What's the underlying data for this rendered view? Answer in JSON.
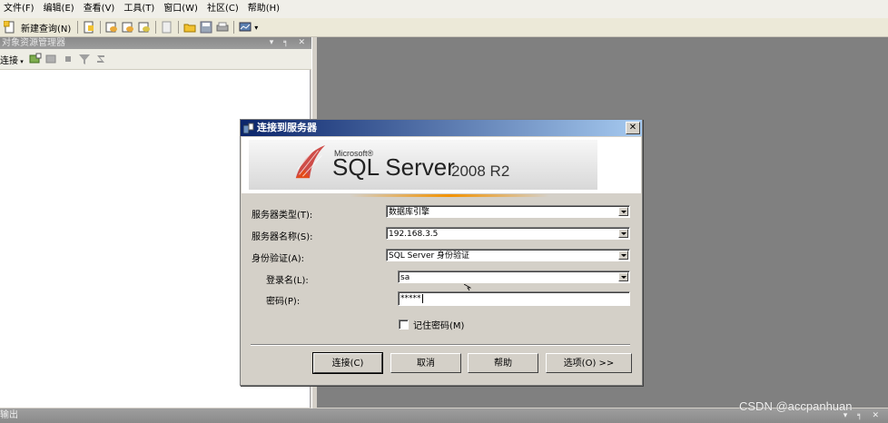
{
  "menu": [
    "文件(F)",
    "编辑(E)",
    "查看(V)",
    "工具(T)",
    "窗口(W)",
    "社区(C)",
    "帮助(H)"
  ],
  "toolbar": {
    "new_query_label": "新建查询(N)"
  },
  "object_explorer": {
    "title": "对象资源管理器",
    "connect_label": "连接",
    "window_controls": "▾ ╕ ✕"
  },
  "output": {
    "title": "输出",
    "window_controls": "▾ ╕ ✕"
  },
  "watermark": "CSDN @accpanhuan",
  "colors": {
    "titlebar_start": "#0a246a",
    "titlebar_end": "#a6caf0",
    "workspace": "#808080",
    "accent": "#f39200"
  },
  "dialog": {
    "title": "连接到服务器",
    "close": "✕",
    "brand": {
      "company": "Microsoft®",
      "product": "SQL Server",
      "version": "2008 R2"
    },
    "fields": {
      "server_type": {
        "label": "服务器类型(T):",
        "value": "数据库引擎"
      },
      "server_name": {
        "label": "服务器名称(S):",
        "value": "192.168.3.5"
      },
      "auth": {
        "label": "身份验证(A):",
        "value": "SQL Server 身份验证"
      },
      "login": {
        "label": "登录名(L):",
        "value": "sa"
      },
      "password": {
        "label": "密码(P):",
        "value": "*****"
      }
    },
    "remember": {
      "label": "记住密码(M)",
      "checked": false
    },
    "buttons": {
      "connect": "连接(C)",
      "cancel": "取消",
      "help": "帮助",
      "options": "选项(O) >>"
    }
  }
}
